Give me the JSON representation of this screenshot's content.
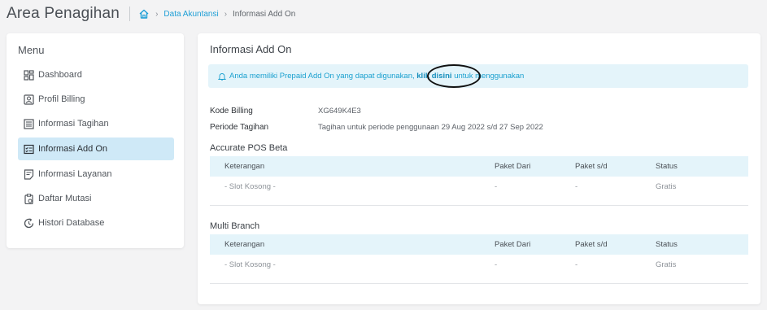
{
  "header": {
    "title": "Area Penagihan",
    "breadcrumb": {
      "home_icon": "home-icon",
      "link": "Data Akuntansi",
      "current": "Informasi Add On"
    }
  },
  "sidebar": {
    "heading": "Menu",
    "items": [
      {
        "label": "Dashboard",
        "icon": "dashboard-icon"
      },
      {
        "label": "Profil Billing",
        "icon": "profile-card-icon"
      },
      {
        "label": "Informasi Tagihan",
        "icon": "invoice-icon"
      },
      {
        "label": "Informasi Add On",
        "icon": "addon-list-icon",
        "active": true
      },
      {
        "label": "Informasi Layanan",
        "icon": "service-doc-icon"
      },
      {
        "label": "Daftar Mutasi",
        "icon": "clipboard-icon"
      },
      {
        "label": "Histori Database",
        "icon": "history-icon"
      }
    ]
  },
  "main": {
    "title": "Informasi Add On",
    "alert": {
      "icon": "bell-icon",
      "text_before": "Anda memiliki Prepaid Add On yang dapat digunakan,",
      "link": "klik disini",
      "text_after": "untuk menggunakan"
    },
    "billing": {
      "kode_label": "Kode Billing",
      "kode_value": "XG649K4E3",
      "periode_label": "Periode Tagihan",
      "periode_value": "Tagihan untuk periode penggunaan 29 Aug 2022 s/d 27 Sep 2022"
    },
    "sections": [
      {
        "title": "Accurate POS Beta",
        "columns": [
          "Keterangan",
          "Paket Dari",
          "Paket s/d",
          "Status"
        ],
        "rows": [
          [
            "- Slot Kosong -",
            "-",
            "-",
            "Gratis"
          ]
        ]
      },
      {
        "title": "Multi Branch",
        "columns": [
          "Keterangan",
          "Paket Dari",
          "Paket s/d",
          "Status"
        ],
        "rows": [
          [
            "- Slot Kosong -",
            "-",
            "-",
            "Gratis"
          ]
        ]
      }
    ]
  },
  "colors": {
    "accent": "#1e9fd6",
    "active_menu_bg": "#cfe9f7",
    "alert_bg": "#e4f4fa",
    "page_bg": "#f3f3f4"
  }
}
